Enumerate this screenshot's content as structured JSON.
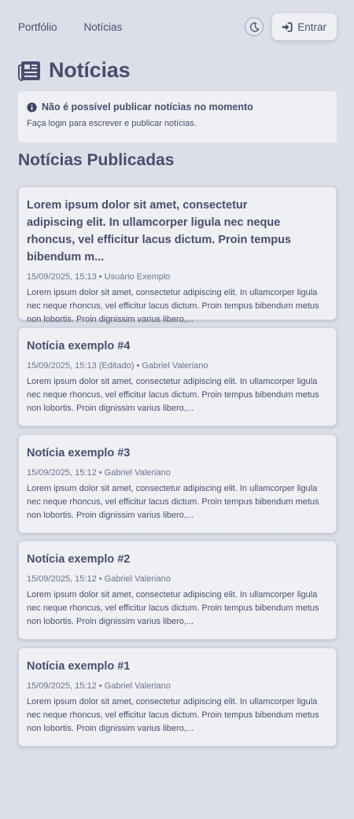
{
  "nav": {
    "links": [
      "Portfólio",
      "Notícias"
    ],
    "theme_toggle_icon": "moon-icon",
    "login_icon": "sign-in-icon",
    "login_label": "Entrar"
  },
  "page": {
    "title_icon": "newspaper-icon",
    "title": "Notícias"
  },
  "notice": {
    "icon": "info-circle-icon",
    "heading": "Não é possível publicar notícias no momento",
    "body": "Faça login para escrever e publicar notícias."
  },
  "section_title": "Notícias Publicadas",
  "articles": [
    {
      "title": "Lorem ipsum dolor sit amet, consectetur adipiscing elit. In ullamcorper ligula nec neque rhoncus, vel efficitur lacus dictum. Proin tempus bibendum m...",
      "meta": "15/09/2025, 15:13 • Usuário Exemplo",
      "excerpt": "Lorem ipsum dolor sit amet, consectetur adipiscing elit. In ullamcorper ligula nec neque rhoncus, vel efficitur lacus dictum. Proin tempus bibendum metus non lobortis. Proin dignissim varius libero,..."
    },
    {
      "title": "Notícia exemplo #4",
      "meta": "15/09/2025, 15:13 (Editado) • Gabriel Valeriano",
      "excerpt": "Lorem ipsum dolor sit amet, consectetur adipiscing elit. In ullamcorper ligula nec neque rhoncus, vel efficitur lacus dictum. Proin tempus bibendum metus non lobortis. Proin dignissim varius libero,..."
    },
    {
      "title": "Notícia exemplo #3",
      "meta": "15/09/2025, 15:12 • Gabriel Valeriano",
      "excerpt": "Lorem ipsum dolor sit amet, consectetur adipiscing elit. In ullamcorper ligula nec neque rhoncus, vel efficitur lacus dictum. Proin tempus bibendum metus non lobortis. Proin dignissim varius libero,..."
    },
    {
      "title": "Notícia exemplo #2",
      "meta": "15/09/2025, 15:12 • Gabriel Valeriano",
      "excerpt": "Lorem ipsum dolor sit amet, consectetur adipiscing elit. In ullamcorper ligula nec neque rhoncus, vel efficitur lacus dictum. Proin tempus bibendum metus non lobortis. Proin dignissim varius libero,..."
    },
    {
      "title": "Notícia exemplo #1",
      "meta": "15/09/2025, 15:12 • Gabriel Valeriano",
      "excerpt": "Lorem ipsum dolor sit amet, consectetur adipiscing elit. In ullamcorper ligula nec neque rhoncus, vel efficitur lacus dictum. Proin tempus bibendum metus non lobortis. Proin dignissim varius libero,..."
    }
  ]
}
